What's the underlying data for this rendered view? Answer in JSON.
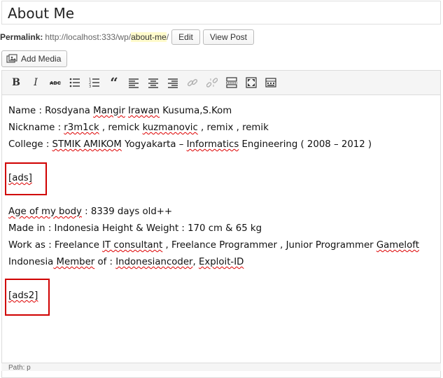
{
  "title": {
    "value": "About Me"
  },
  "permalink": {
    "label": "Permalink:",
    "url_base": "http://localhost:333/wp/",
    "slug": "about-me",
    "slash": "/",
    "edit_label": "Edit",
    "view_label": "View Post"
  },
  "media": {
    "add_label": "Add Media"
  },
  "toolbar": {
    "buttons": [
      "bold",
      "italic",
      "strikethrough",
      "bullet-list",
      "numbered-list",
      "blockquote",
      "align-left",
      "align-center",
      "align-right",
      "link",
      "unlink",
      "read-more",
      "fullscreen",
      "kitchen-sink"
    ]
  },
  "content": {
    "name_label": "Name : ",
    "name_first": "Rosdyana",
    "name_mid": "Mangir",
    "name_mid2": "Irawan",
    "name_rest": "Kusuma,S.Kom",
    "nick_label": "Nickname : ",
    "nick_1": "r3m1ck",
    "nick_sep1": " , remick ",
    "nick_2": "kuzmanovic",
    "nick_sep2": " , ",
    "nick_3": "remix",
    "nick_sep3": " , ",
    "nick_4": "remik",
    "college_label": "College : ",
    "college_1": "STMIK AMIKOM",
    "college_2": " Yogyakarta – ",
    "college_3": "Informatics",
    "college_4": " Engineering ( 2008 – 2012 )",
    "ads1": "[ads]",
    "age_1": "Age of my body",
    "age_2": " : 8339 days old++",
    "made": "Made in : Indonesia Height & Weight : 170 cm & 65 kg",
    "work_1": "Work as : Freelance ",
    "work_2": "IT consultant",
    "work_3": " , Freelance Programmer , Junior Programmer ",
    "work_4": "Gameloft",
    "member_1": "Indonesia",
    "member_2": " Member",
    "member_3": " of : ",
    "member_4": "Indonesiancoder",
    "member_5": ", ",
    "member_6": "Exploit-ID",
    "ads2": "[ads2]"
  },
  "status": {
    "path_label": "Path: p"
  }
}
